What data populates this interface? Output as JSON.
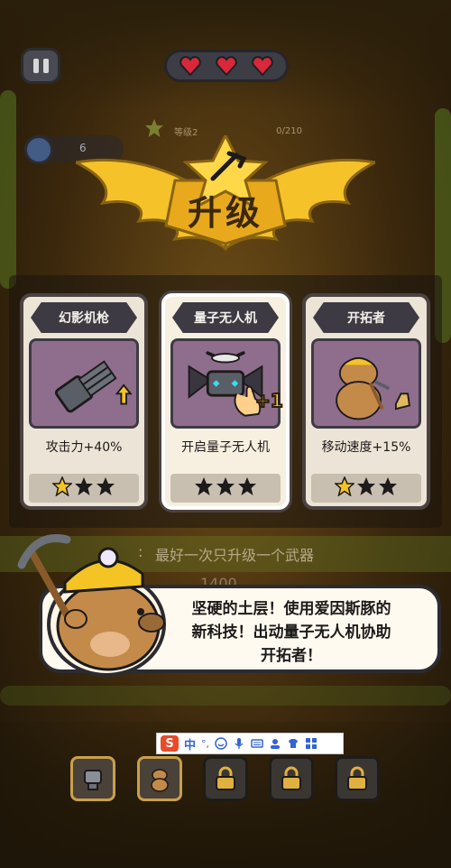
{
  "hud": {
    "pause_label": "",
    "hearts_count": 3,
    "xp_level": "等级2",
    "xp_progress": "0/210",
    "depth_value": "6"
  },
  "title": "升级",
  "cards": [
    {
      "tag": "幻影机枪",
      "desc": "攻击力+40%",
      "stars_filled": 1,
      "stars_total": 3,
      "selected": false,
      "image_icon": "gatling-gun-icon"
    },
    {
      "tag": "量子无人机",
      "desc": "开启量子无人机",
      "stars_filled": 0,
      "stars_total": 3,
      "selected": true,
      "image_icon": "drone-icon"
    },
    {
      "tag": "开拓者",
      "desc": "移动速度+15%",
      "stars_filled": 1,
      "stars_total": 3,
      "selected": false,
      "image_icon": "capybara-miner-icon"
    }
  ],
  "plus_one": "+1",
  "hint": {
    "text": "最好一次只升级一个武器",
    "faded_number": "1400"
  },
  "dialog": {
    "line1": "坚硬的土层！使用爱因斯豚的",
    "line2": "新科技！出动量子无人机协助",
    "line3": "开拓者！"
  },
  "slots": [
    {
      "state": "filled",
      "icon": "gatling-gun-icon"
    },
    {
      "state": "filled",
      "icon": "capybara-miner-icon"
    },
    {
      "state": "locked",
      "icon": "lock-icon"
    },
    {
      "state": "locked",
      "icon": "lock-icon"
    },
    {
      "state": "locked",
      "icon": "lock-icon"
    }
  ],
  "ime": {
    "logo": "S",
    "lang": "中",
    "punct": "°,"
  },
  "colors": {
    "gold": "#f5c22a",
    "card_border": "#4b4242",
    "heart": "#d8283a",
    "star_filled": "#f3c423",
    "star_empty": "#1c1a1a"
  }
}
